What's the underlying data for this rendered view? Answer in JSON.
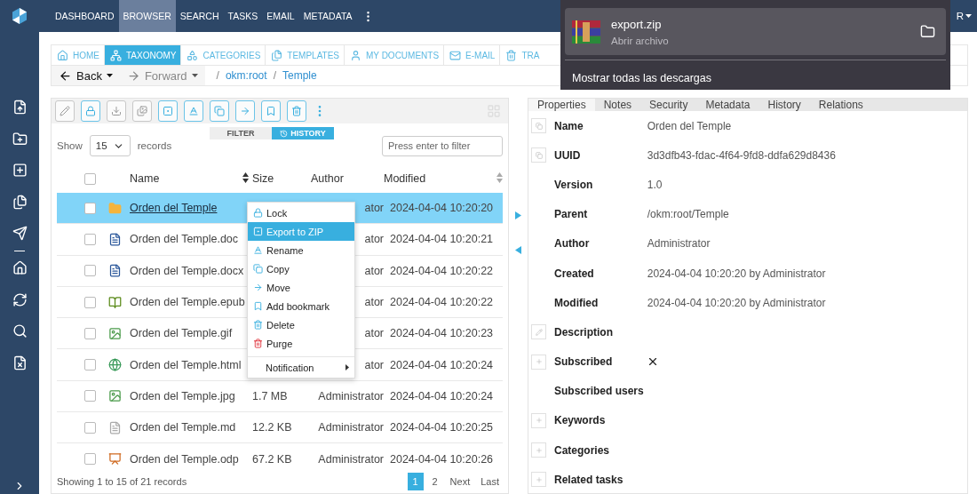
{
  "top_nav": {
    "items": [
      {
        "label": "DASHBOARD",
        "selected": false
      },
      {
        "label": "BROWSER",
        "selected": true
      },
      {
        "label": "SEARCH",
        "selected": false
      },
      {
        "label": "TASKS",
        "selected": false
      },
      {
        "label": "EMAIL",
        "selected": false
      },
      {
        "label": "METADATA",
        "selected": false
      }
    ],
    "user_menu": "R"
  },
  "nav_tabs": [
    {
      "label": "HOME",
      "selected": false
    },
    {
      "label": "TAXONOMY",
      "selected": true
    },
    {
      "label": "CATEGORIES",
      "selected": false
    },
    {
      "label": "TEMPLATES",
      "selected": false
    },
    {
      "label": "MY DOCUMENTS",
      "selected": false
    },
    {
      "label": "E-MAIL",
      "selected": false
    },
    {
      "label": "TRA",
      "selected": false
    }
  ],
  "history_nav": {
    "back": "Back",
    "forward": "Forward",
    "forward_disabled": true
  },
  "breadcrumb": [
    {
      "separator": "/",
      "label": "okm:root"
    },
    {
      "separator": "/",
      "label": "Temple"
    }
  ],
  "toolbar": [
    {
      "disabled": true
    },
    {
      "disabled": false
    },
    {
      "disabled": true
    },
    {
      "disabled": true
    },
    {
      "disabled": false
    },
    {
      "disabled": false
    },
    {
      "disabled": false
    },
    {
      "disabled": false
    },
    {
      "disabled": false
    },
    {
      "disabled": false
    }
  ],
  "view_tabs": [
    {
      "label": "FILTER",
      "selected": false
    },
    {
      "label": "HISTORY",
      "selected": true
    }
  ],
  "page_size": {
    "before": "Show",
    "value": "15",
    "after": "records"
  },
  "filter": {
    "placeholder": "Press enter to filter"
  },
  "table": {
    "select_all_checked": false,
    "columns": [
      "Name",
      "Size",
      "Author",
      "Modified"
    ],
    "rows": [
      {
        "name": "Orden del Temple",
        "kind": "folder",
        "author": "ator",
        "modified": "2024-04-04 10:20:20",
        "selected": true,
        "checked": false
      },
      {
        "name": "Orden del Temple.doc",
        "kind": "doc",
        "author": "ator",
        "modified": "2024-04-04 10:20:21",
        "selected": false,
        "checked": false
      },
      {
        "name": "Orden del Temple.docx",
        "kind": "docx",
        "author": "ator",
        "modified": "2024-04-04 10:20:22",
        "selected": false,
        "checked": false
      },
      {
        "name": "Orden del Temple.epub",
        "kind": "epub",
        "author": "ator",
        "modified": "2024-04-04 10:20:22",
        "selected": false,
        "checked": false
      },
      {
        "name": "Orden del Temple.gif",
        "kind": "image",
        "author": "ator",
        "modified": "2024-04-04 10:20:23",
        "selected": false,
        "checked": false
      },
      {
        "name": "Orden del Temple.html",
        "kind": "html",
        "author": "ator",
        "modified": "2024-04-04 10:20:24",
        "selected": false,
        "checked": false
      },
      {
        "name": "Orden del Temple.jpg",
        "kind": "image",
        "size": "1.7 MB",
        "author": "Administrator",
        "modified": "2024-04-04 10:20:24",
        "selected": false,
        "checked": false
      },
      {
        "name": "Orden del Temple.md",
        "kind": "text",
        "size": "12.2 KB",
        "author": "Administrator",
        "modified": "2024-04-04 10:20:25",
        "selected": false,
        "checked": false
      },
      {
        "name": "Orden del Temple.odp",
        "kind": "presentation",
        "size": "67.2 KB",
        "author": "Administrator",
        "modified": "2024-04-04 10:20:26",
        "selected": false,
        "checked": false
      }
    ]
  },
  "context_menu": [
    {
      "label": "Lock",
      "kind": "action",
      "selected": false
    },
    {
      "label": "Export to ZIP",
      "kind": "action",
      "selected": true
    },
    {
      "label": "Rename",
      "kind": "action",
      "selected": false
    },
    {
      "label": "Copy",
      "kind": "action",
      "selected": false
    },
    {
      "label": "Move",
      "kind": "action",
      "selected": false
    },
    {
      "label": "Add bookmark",
      "kind": "action",
      "selected": false
    },
    {
      "label": "Delete",
      "kind": "action",
      "selected": false
    },
    {
      "label": "Purge",
      "kind": "danger",
      "selected": false
    },
    {
      "label": "Notification",
      "kind": "submenu",
      "selected": false
    }
  ],
  "footer": {
    "summary": "Showing 1 to 15 of 21 records",
    "pages": [
      {
        "label": "1",
        "selected": true
      },
      {
        "label": "2",
        "selected": false
      },
      {
        "label": "Next",
        "selected": false
      },
      {
        "label": "Last",
        "selected": false
      }
    ]
  },
  "details": {
    "tabs": [
      {
        "label": "Properties",
        "selected": true
      },
      {
        "label": "Notes",
        "selected": false
      },
      {
        "label": "Security",
        "selected": false
      },
      {
        "label": "Metadata",
        "selected": false
      },
      {
        "label": "History",
        "selected": false
      },
      {
        "label": "Relations",
        "selected": false
      }
    ],
    "properties": [
      {
        "label": "Name",
        "kind": "copyable",
        "value": "Orden del Temple"
      },
      {
        "label": "UUID",
        "kind": "copyable",
        "value": "3d3dfb43-fdac-4f64-9fd8-ddfa629d8436"
      },
      {
        "label": "Version",
        "kind": "plain",
        "value": "1.0"
      },
      {
        "label": "Parent",
        "kind": "plain",
        "value": "/okm:root/Temple"
      },
      {
        "label": "Author",
        "kind": "plain",
        "value": "Administrator"
      },
      {
        "label": "Created",
        "kind": "plain",
        "value": "2024-04-04 10:20:20 by Administrator"
      },
      {
        "label": "Modified",
        "kind": "plain",
        "value": "2024-04-04 10:20:20 by Administrator"
      },
      {
        "label": "Description",
        "kind": "editable"
      },
      {
        "label": "Subscribed",
        "kind": "addable",
        "on": false
      },
      {
        "label": "Subscribed users",
        "kind": "plain"
      },
      {
        "label": "Keywords",
        "kind": "addable"
      },
      {
        "label": "Categories",
        "kind": "addable"
      },
      {
        "label": "Related tasks",
        "kind": "addable"
      }
    ]
  },
  "downloads": {
    "file": "export.zip",
    "action": "Abrir archivo",
    "show_all": "Mostrar todas las descargas"
  }
}
